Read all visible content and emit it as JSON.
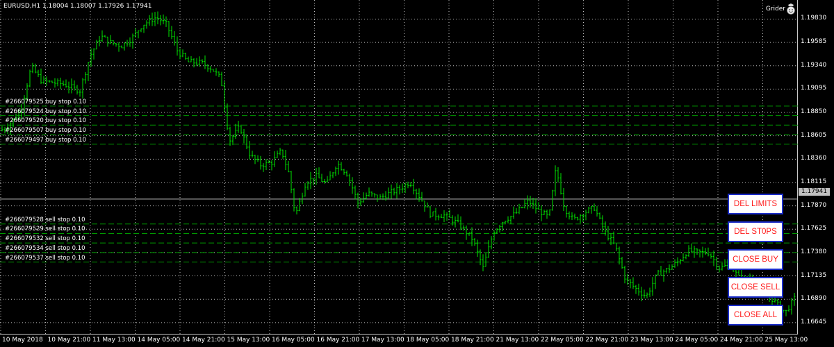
{
  "chart_title": "EURUSD,H1  1.18004 1.18007 1.17926 1.17941",
  "ea_name": "Grider",
  "current_price": "1.17941",
  "price_levels": [
    "1.19830",
    "1.19585",
    "1.19340",
    "1.19095",
    "1.18850",
    "1.18605",
    "1.18360",
    "1.18115",
    "1.17870",
    "1.17625",
    "1.17380",
    "1.17135",
    "1.16890",
    "1.16645"
  ],
  "time_labels": [
    "10 May 2018",
    "10 May 21:00",
    "11 May 13:00",
    "14 May 05:00",
    "14 May 21:00",
    "15 May 13:00",
    "16 May 05:00",
    "16 May 21:00",
    "17 May 13:00",
    "18 May 05:00",
    "18 May 21:00",
    "21 May 13:00",
    "22 May 05:00",
    "22 May 21:00",
    "23 May 13:00",
    "24 May 05:00",
    "24 May 21:00",
    "25 May 13:00"
  ],
  "orders": [
    {
      "label": "#266079525 buy stop 0.10",
      "price": 1.18917
    },
    {
      "label": "#266079524 buy stop 0.10",
      "price": 1.18817
    },
    {
      "label": "#266079520 buy stop 0.10",
      "price": 1.18717
    },
    {
      "label": "#266079507 buy stop 0.10",
      "price": 1.18617
    },
    {
      "label": "#266079497 buy stop 0.10",
      "price": 1.18517
    },
    {
      "label": "#266079528 sell stop 0.10",
      "price": 1.1768
    },
    {
      "label": "#266079529 sell stop 0.10",
      "price": 1.1758
    },
    {
      "label": "#266079532 sell stop 0.10",
      "price": 1.1748
    },
    {
      "label": "#266079534 sell stop 0.10",
      "price": 1.1738
    },
    {
      "label": "#266079537 sell stop 0.10",
      "price": 1.1728
    }
  ],
  "buttons": {
    "del_limits": "DEL LIMITS",
    "del_stops": "DEL ST0PS",
    "close_buy": "CLOSE BUY",
    "close_sell": "CLOSE SELL",
    "close_all": "CLOSE ALL"
  },
  "colors": {
    "bar": "#00e600",
    "order_line": "#009900",
    "grid": "#c0c0c0",
    "button_text": "#ff1a1a",
    "button_border": "#1a2cc8"
  },
  "chart_data": {
    "type": "ohlc",
    "ylim": [
      1.1652,
      1.2003
    ],
    "close_path": [
      [
        0,
        1.1866
      ],
      [
        10,
        1.1869
      ],
      [
        30,
        1.1887
      ],
      [
        45,
        1.1933
      ],
      [
        60,
        1.1918
      ],
      [
        90,
        1.1915
      ],
      [
        115,
        1.1908
      ],
      [
        130,
        1.1945
      ],
      [
        145,
        1.1965
      ],
      [
        160,
        1.1958
      ],
      [
        175,
        1.1955
      ],
      [
        190,
        1.1963
      ],
      [
        205,
        1.1977
      ],
      [
        225,
        1.1985
      ],
      [
        240,
        1.1977
      ],
      [
        255,
        1.195
      ],
      [
        270,
        1.1938
      ],
      [
        290,
        1.1937
      ],
      [
        305,
        1.1931
      ],
      [
        318,
        1.192
      ],
      [
        330,
        1.1855
      ],
      [
        345,
        1.187
      ],
      [
        360,
        1.184
      ],
      [
        375,
        1.183
      ],
      [
        390,
        1.1832
      ],
      [
        405,
        1.1845
      ],
      [
        415,
        1.1822
      ],
      [
        425,
        1.1777
      ],
      [
        440,
        1.1812
      ],
      [
        455,
        1.1818
      ],
      [
        470,
        1.181
      ],
      [
        485,
        1.1832
      ],
      [
        500,
        1.182
      ],
      [
        515,
        1.179
      ],
      [
        530,
        1.18
      ],
      [
        545,
        1.1795
      ],
      [
        560,
        1.18
      ],
      [
        575,
        1.1805
      ],
      [
        590,
        1.1812
      ],
      [
        605,
        1.1795
      ],
      [
        620,
        1.1778
      ],
      [
        640,
        1.1777
      ],
      [
        660,
        1.1768
      ],
      [
        680,
        1.1752
      ],
      [
        695,
        1.1722
      ],
      [
        710,
        1.176
      ],
      [
        725,
        1.1772
      ],
      [
        740,
        1.1778
      ],
      [
        760,
        1.1792
      ],
      [
        775,
        1.1782
      ],
      [
        790,
        1.1775
      ],
      [
        800,
        1.1827
      ],
      [
        812,
        1.1785
      ],
      [
        825,
        1.1772
      ],
      [
        840,
        1.178
      ],
      [
        855,
        1.1785
      ],
      [
        870,
        1.176
      ],
      [
        885,
        1.1745
      ],
      [
        900,
        1.171
      ],
      [
        915,
        1.17
      ],
      [
        930,
        1.1692
      ],
      [
        945,
        1.1715
      ],
      [
        960,
        1.172
      ],
      [
        975,
        1.1728
      ],
      [
        990,
        1.174
      ],
      [
        1005,
        1.1738
      ],
      [
        1020,
        1.1738
      ],
      [
        1035,
        1.1722
      ],
      [
        1050,
        1.1725
      ],
      [
        1065,
        1.171
      ],
      [
        1080,
        1.171
      ],
      [
        1095,
        1.1695
      ],
      [
        1110,
        1.169
      ],
      [
        1130,
        1.1675
      ],
      [
        1147,
        1.1694
      ]
    ]
  }
}
